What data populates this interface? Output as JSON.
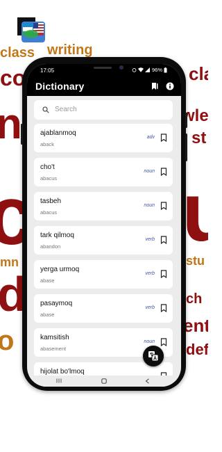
{
  "background_words": [
    "class",
    "writing",
    "co",
    "class",
    "ng",
    "wle",
    "st",
    "c",
    "u",
    "mn",
    "stu",
    "d",
    "ent",
    "o",
    "defi",
    "ch"
  ],
  "status_bar": {
    "time": "17:05",
    "battery": "96%"
  },
  "app_bar": {
    "title": "Dictionary",
    "icons": [
      "bookmarks-icon",
      "info-icon"
    ]
  },
  "search": {
    "placeholder": "Search"
  },
  "entries": [
    {
      "word": "ajablanmoq",
      "translation": "aback",
      "pos": "adv"
    },
    {
      "word": "cho't",
      "translation": "abacus",
      "pos": "noun"
    },
    {
      "word": "tasbeh",
      "translation": "abacus",
      "pos": "noun"
    },
    {
      "word": "tark qilmoq",
      "translation": "abandon",
      "pos": "verb"
    },
    {
      "word": "yerga urmoq",
      "translation": "abase",
      "pos": "verb"
    },
    {
      "word": "pasaymoq",
      "translation": "abase",
      "pos": "verb"
    },
    {
      "word": "kamsitish",
      "translation": "abasement",
      "pos": "noun"
    },
    {
      "word": "hijolat bo'lmoq",
      "translation": "",
      "pos": ""
    }
  ],
  "colors": {
    "accent": "#3b55a8",
    "app_bar": "#000000",
    "list_bg": "#ececec",
    "word_cloud_red": "#8f1010",
    "word_cloud_orange": "#c46a10"
  }
}
